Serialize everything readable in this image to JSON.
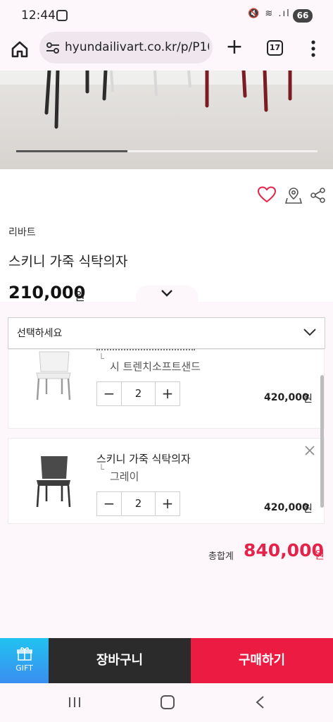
{
  "status_bar": {
    "time": "12:44",
    "battery": "66"
  },
  "browser": {
    "url": "hyundailivart.co.kr/p/P10",
    "tab_count": "17"
  },
  "product": {
    "brand": "리바트",
    "name": "스키니 가죽 식탁의자",
    "price": "210,000",
    "price_unit": "원",
    "image_scroll_progress": 0.37
  },
  "options": {
    "select_placeholder": "선택하세요",
    "items": [
      {
        "option_name": "시 트렌치소프트샌드",
        "quantity": "2",
        "line_price": "420,000",
        "price_unit": "원",
        "chair_color": "#f2f2f2"
      },
      {
        "product_name": "스키니 가죽 식탁의자",
        "option_name": "그레이",
        "quantity": "2",
        "line_price": "420,000",
        "price_unit": "원",
        "chair_color": "#4a4a4a"
      }
    ],
    "total_label": "총합계",
    "total_price": "840,000",
    "total_unit": "원"
  },
  "actions": {
    "gift_label": "GIFT",
    "cart_label": "장바구니",
    "buy_label": "구매하기"
  },
  "colors": {
    "accent": "#ec1b42",
    "total": "#e5234a",
    "gift_gradient_top": "#21c3f0",
    "cart": "#2b2b2b"
  }
}
